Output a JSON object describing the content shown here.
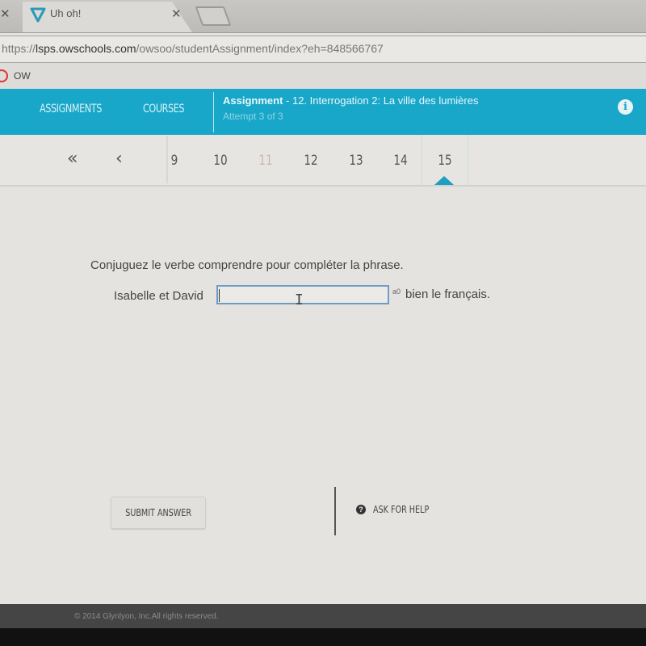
{
  "browser": {
    "tab_title": "Uh oh!",
    "url_scheme": "https://",
    "url_host": "lsps.owschools.com",
    "url_path": "/owsoo/studentAssignment/index?eh=848566767",
    "bookmark_label": "OW"
  },
  "header": {
    "nav": [
      {
        "label": "ASSIGNMENTS"
      },
      {
        "label": "COURSES"
      }
    ],
    "assignment_label": "Assignment",
    "assignment_title": " - 12. Interrogation 2: La ville des lumières",
    "attempt": "Attempt 3 of 3",
    "info_icon": "i"
  },
  "pager": {
    "first": "«",
    "prev": "‹",
    "pages": [
      "9",
      "10",
      "11",
      "12",
      "13",
      "14",
      "15"
    ],
    "current": "15"
  },
  "question": {
    "prompt": "Conjuguez le verbe comprendre pour compléter la phrase.",
    "sentence_start": "Isabelle et David",
    "answer_value": "",
    "artifact": "a0",
    "sentence_end": "bien le français."
  },
  "actions": {
    "submit_label": "SUBMIT ANSWER",
    "help_label": "ASK FOR HELP",
    "help_icon": "?"
  },
  "footer": {
    "copyright": "© 2014 Glynlyon, Inc.All rights reserved."
  },
  "colors": {
    "brand": "#18a7c9",
    "footer": "#454545"
  }
}
